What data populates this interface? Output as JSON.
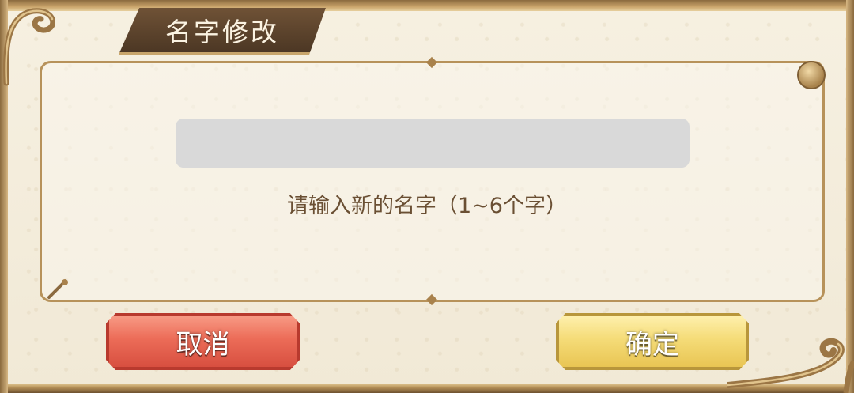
{
  "dialog": {
    "title": "名字修改",
    "input": {
      "value": "",
      "placeholder": ""
    },
    "hint": "请输入新的名字（1~6个字）",
    "cancel_label": "取消",
    "confirm_label": "确定"
  },
  "icons": [
    "scroll-ornament-icon",
    "corner-knob-icon",
    "quill-pen-icon",
    "diamond-ornament-icon"
  ],
  "colors": {
    "panel": "#f3ecdb",
    "frame": "#b7925a",
    "title_bg": "#5c432d",
    "cancel": "#ec6c58",
    "confirm": "#f5dc78",
    "hint_text": "#6a4f33"
  }
}
